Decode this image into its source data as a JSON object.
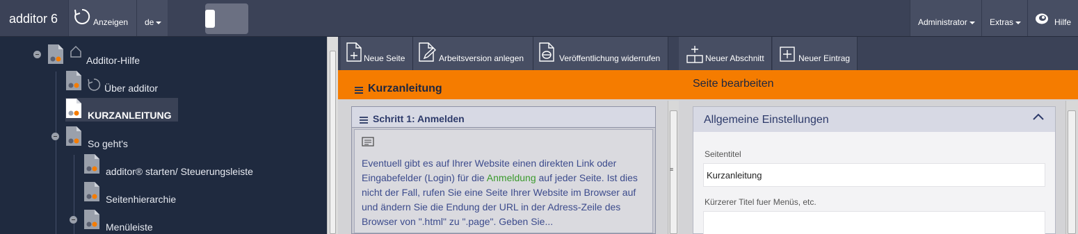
{
  "topbar": {
    "brand": "additor 6",
    "anzeigen": "Anzeigen",
    "lang": "de",
    "admin": "Administrator",
    "extras": "Extras",
    "hilfe": "Hilfe"
  },
  "tree": {
    "items": [
      {
        "label": "Additor-Hilfe"
      },
      {
        "label": "Über additor"
      },
      {
        "label": "KURZANLEITUNG"
      },
      {
        "label": "So geht's"
      },
      {
        "label": "additor® starten/ Steuerungsleiste"
      },
      {
        "label": "Seitenhierarchie"
      },
      {
        "label": "Menüleiste"
      }
    ]
  },
  "toolbar": {
    "neue_seite": "Neue Seite",
    "arbeitsversion": "Arbeitsversion anlegen",
    "veroeffentlichung": "Veröffentlichung widerrufen",
    "neuer_abschnitt": "Neuer Abschnitt",
    "neuer_eintrag": "Neuer Eintrag"
  },
  "header": {
    "title": "Kurzanleitung",
    "subtitle": "Seite bearbeiten"
  },
  "step": {
    "title": "Schritt 1: Anmelden",
    "text_before": "Eventuell gibt es auf Ihrer Website einen direkten Link oder Eingabefelder (Login) für die ",
    "link": "Anmeldung",
    "text_after": " auf jeder Seite. Ist dies nicht der Fall, rufen Sie eine Seite Ihrer Website im Browser auf und ändern Sie die Endung der URL in der Adress-Zeile des Browser von \".html\" zu \".page\". Geben Sie..."
  },
  "settings": {
    "title": "Allgemeine Einstellungen",
    "seitentitel_label": "Seitentitel",
    "seitentitel_value": "Kurzanleitung",
    "kurztitel_label": "Kürzerer Titel fuer Menüs, etc.",
    "kurztitel_value": ""
  },
  "colors": {
    "accent": "#f57c00",
    "link": "#3a9a2c",
    "sidebar_bg": "#1f2a3f",
    "topbar_bg": "#3b4257"
  }
}
